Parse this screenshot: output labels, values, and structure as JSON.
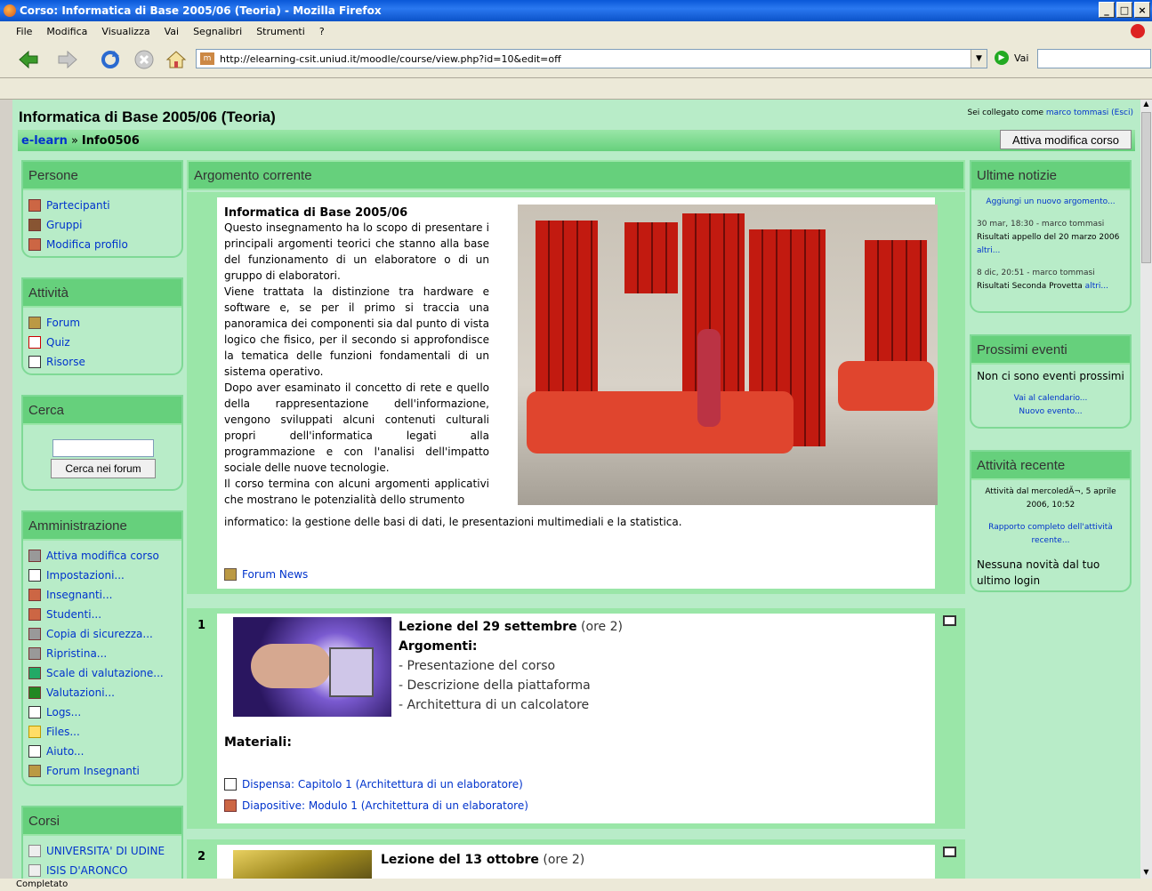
{
  "window": {
    "title": "Corso: Informatica di Base 2005/06 (Teoria) - Mozilla Firefox"
  },
  "menu": [
    "File",
    "Modifica",
    "Visualizza",
    "Vai",
    "Segnalibri",
    "Strumenti",
    "?"
  ],
  "nav": {
    "url": "http://elearning-csit.uniud.it/moodle/course/view.php?id=10&edit=off",
    "go_label": "Vai"
  },
  "status": "Completato",
  "course": {
    "title": "Informatica di Base 2005/06 (Teoria)",
    "login_prefix": "Sei collegato come",
    "login_user": "marco tommasi",
    "logout": "(Esci)",
    "breadcrumb_home": "e-learn",
    "breadcrumb_sep": "»",
    "breadcrumb_current": "Info0506",
    "edit_button": "Attiva modifica corso"
  },
  "left": {
    "persone": {
      "title": "Persone",
      "items": [
        "Partecipanti",
        "Gruppi",
        "Modifica profilo"
      ]
    },
    "attivita": {
      "title": "Attività",
      "items": [
        "Forum",
        "Quiz",
        "Risorse"
      ]
    },
    "cerca": {
      "title": "Cerca",
      "button": "Cerca nei forum",
      "value": ""
    },
    "admin": {
      "title": "Amministrazione",
      "items": [
        "Attiva modifica corso",
        "Impostazioni...",
        "Insegnanti...",
        "Studenti...",
        "Copia di sicurezza...",
        "Ripristina...",
        "Scale di valutazione...",
        "Valutazioni...",
        "Logs...",
        "Files...",
        "Aiuto...",
        "Forum Insegnanti"
      ]
    },
    "corsi": {
      "title": "Corsi",
      "items": [
        "UNIVERSITA' DI UDINE",
        "ISIS D'ARONCO"
      ]
    }
  },
  "center": {
    "heading": "Argomento corrente",
    "intro_title": "Informatica di Base 2005/06",
    "intro_p1": "Questo insegnamento ha lo scopo di presentare i principali argomenti teorici che stanno alla base del funzionamento di un elaboratore o di un gruppo di elaboratori.",
    "intro_p2": "Viene trattata la distinzione tra hardware e software e, se per il primo si traccia una panoramica dei componenti sia dal punto di vista logico che fisico, per il secondo si approfondisce la tematica delle funzioni fondamentali di un sistema operativo.",
    "intro_p3": "Dopo aver esaminato il concetto di rete e quello della rappresentazione dell'informazione, vengono sviluppati alcuni contenuti culturali propri dell'informatica legati alla programmazione e con l'analisi dell'impatto sociale delle nuove tecnologie.",
    "intro_p4a": "Il corso termina con alcuni argomenti applicativi che mostrano le potenzialità dello strumento",
    "intro_p4b": "informatico: la gestione delle basi di dati, le presentazioni multimediali e la statistica.",
    "forum_news": "Forum News",
    "s1": {
      "num": "1",
      "title": "Lezione del 29 settembre",
      "hours": "(ore 2)",
      "topics_label": "Argomenti:",
      "topics": [
        "- Presentazione del corso",
        "- Descrizione della piattaforma",
        "- Architettura di un calcolatore"
      ],
      "materials_label": "Materiali:",
      "materials": [
        "Dispensa: Capitolo 1 (Architettura di un elaboratore)",
        "Diapositive: Modulo 1 (Architettura di un elaboratore)"
      ]
    },
    "s2": {
      "num": "2",
      "title": "Lezione del 13 ottobre",
      "hours": "(ore 2)"
    }
  },
  "right": {
    "news": {
      "title": "Ultime notizie",
      "add": "Aggiungi un nuovo argomento...",
      "item1_meta": "30 mar, 18:30 - marco tommasi",
      "item1_text": "Risultati appello del 20 marzo 2006",
      "item1_more": "altri...",
      "item2_meta": "8 dic, 20:51 - marco tommasi",
      "item2_text": "Risultati Seconda Provetta",
      "item2_more": "altri..."
    },
    "events": {
      "title": "Prossimi eventi",
      "none": "Non ci sono eventi prossimi",
      "calendar": "Vai al calendario...",
      "new": "Nuovo evento..."
    },
    "recent": {
      "title": "Attività recente",
      "since": "Attività dal mercoledÃ¬, 5 aprile 2006, 10:52",
      "report": "Rapporto completo dell'attività recente...",
      "none": "Nessuna novità dal tuo ultimo login"
    }
  }
}
